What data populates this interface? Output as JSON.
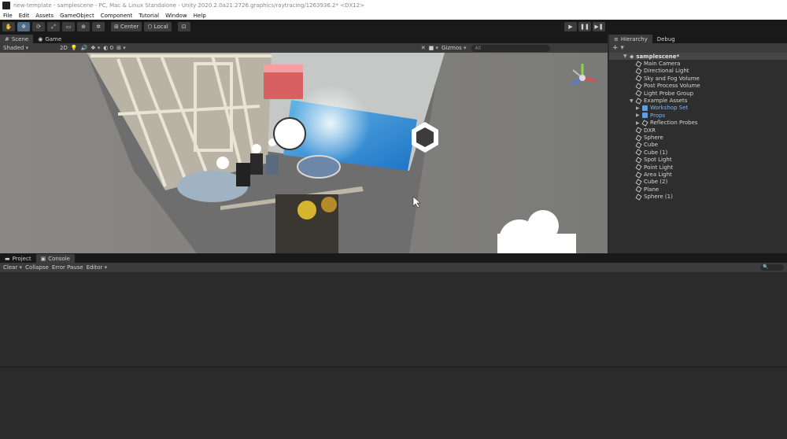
{
  "title": "new-template - samplescene - PC, Mac & Linux Standalone - Unity 2020.2.0a21.2726.graphics/raytracing/1263936.2* <DX12>",
  "menu": [
    "File",
    "Edit",
    "Assets",
    "GameObject",
    "Component",
    "Tutorial",
    "Window",
    "Help"
  ],
  "toolbar": {
    "tools": [
      "hand-tool",
      "move-tool",
      "rotate-tool",
      "scale-tool",
      "rect-tool",
      "transform-tool",
      "custom-tool"
    ],
    "pivot_label": "Center",
    "space_label": "Local"
  },
  "scene": {
    "tabs": [
      "Scene",
      "Game"
    ],
    "draw_mode": "Shaded",
    "mode_2d": "2D",
    "gizmos_label": "Gizmos",
    "search_placeholder": "All"
  },
  "hierarchy": {
    "tabs": [
      "Hierarchy",
      "Debug"
    ],
    "add_label": "+",
    "scene_name": "samplescene*",
    "items": [
      {
        "label": "Main Camera"
      },
      {
        "label": "Directional Light"
      },
      {
        "label": "Sky and Fog Volume"
      },
      {
        "label": "Post Process Volume"
      },
      {
        "label": "Light Probe Group"
      },
      {
        "label": "Example Assets"
      },
      {
        "label": "Workshop Set"
      },
      {
        "label": "Props"
      },
      {
        "label": "Reflection Probes"
      },
      {
        "label": "DXR"
      },
      {
        "label": "Sphere"
      },
      {
        "label": "Cube"
      },
      {
        "label": "Cube (1)"
      },
      {
        "label": "Spot Light"
      },
      {
        "label": "Point Light"
      },
      {
        "label": "Area Light"
      },
      {
        "label": "Cube (2)"
      },
      {
        "label": "Plane"
      },
      {
        "label": "Sphere (1)"
      }
    ]
  },
  "bottom": {
    "tabs": [
      "Project",
      "Console"
    ],
    "clear_label": "Clear",
    "collapse_label": "Collapse",
    "error_pause_label": "Error Pause",
    "editor_label": "Editor"
  },
  "colors": {
    "panel": "#3c3c3c",
    "dark": "#191919",
    "selection": "#4d6a8a",
    "prefab": "#5d9ee6"
  }
}
